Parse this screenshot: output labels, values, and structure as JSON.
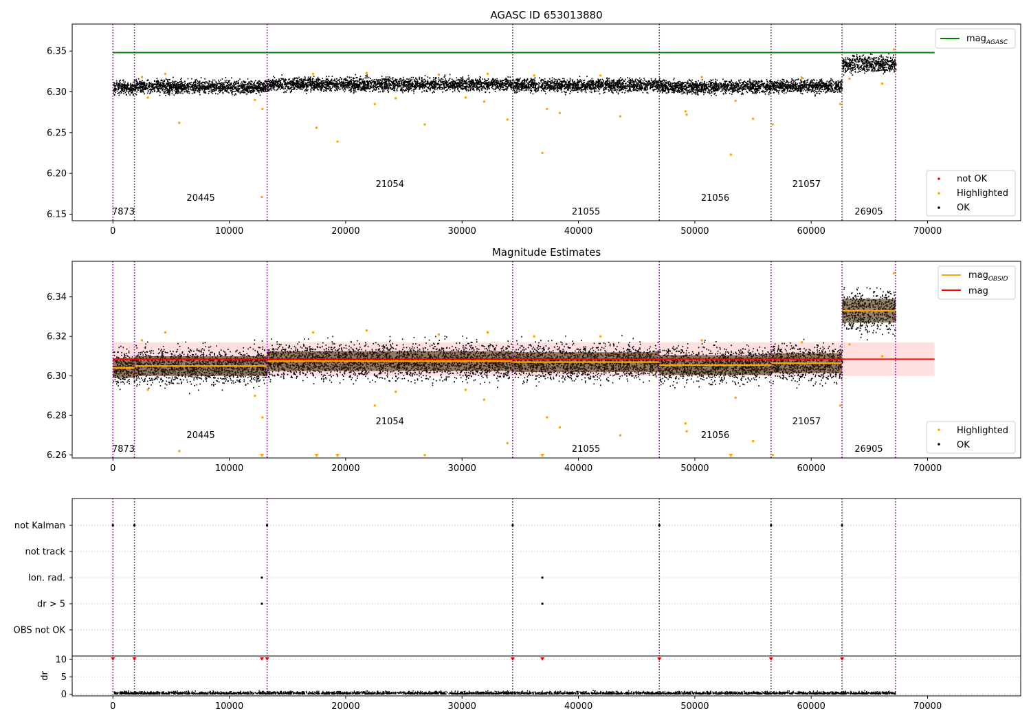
{
  "chart_data": [
    {
      "type": "scatter",
      "title": "AGASC ID 653013880",
      "xlim": [
        -3500,
        78000
      ],
      "ylim": [
        6.142,
        6.383
      ],
      "x_ticks": [
        0,
        10000,
        20000,
        30000,
        40000,
        50000,
        60000,
        70000
      ],
      "y_ticks": [
        6.15,
        6.2,
        6.25,
        6.3,
        6.35
      ],
      "obs_boundaries": [
        0,
        1850,
        13250,
        34350,
        46950,
        56550,
        62650,
        67250
      ],
      "obsid_labels": [
        {
          "text": "7873",
          "x": 900,
          "row": 2
        },
        {
          "text": "20445",
          "x": 7550,
          "row": 1
        },
        {
          "text": "21054",
          "x": 23800,
          "row": 0
        },
        {
          "text": "21055",
          "x": 40650,
          "row": 2
        },
        {
          "text": "21056",
          "x": 51750,
          "row": 1
        },
        {
          "text": "21057",
          "x": 59600,
          "row": 0
        },
        {
          "text": "26905",
          "x": 64950,
          "row": 2
        }
      ],
      "mag_agasc": 6.348,
      "series": [
        {
          "name": "OK",
          "color": "#000000",
          "segments": [
            {
              "x0": 0,
              "x1": 1850,
              "mean": 6.305,
              "spread": 0.008
            },
            {
              "x0": 1850,
              "x1": 13250,
              "mean": 6.306,
              "spread": 0.008
            },
            {
              "x0": 13250,
              "x1": 34350,
              "mean": 6.309,
              "spread": 0.008
            },
            {
              "x0": 34350,
              "x1": 46950,
              "mean": 6.308,
              "spread": 0.008
            },
            {
              "x0": 46950,
              "x1": 56550,
              "mean": 6.306,
              "spread": 0.008
            },
            {
              "x0": 56550,
              "x1": 62650,
              "mean": 6.307,
              "spread": 0.008
            },
            {
              "x0": 62650,
              "x1": 67250,
              "mean": 6.334,
              "spread": 0.01
            }
          ]
        },
        {
          "name": "Highlighted",
          "color": "#ffa500",
          "points": [
            [
              5700,
              6.262
            ],
            [
              12850,
              6.279
            ],
            [
              12800,
              6.171
            ],
            [
              17500,
              6.256
            ],
            [
              19300,
              6.239
            ],
            [
              22500,
              6.285
            ],
            [
              26800,
              6.26
            ],
            [
              33900,
              6.266
            ],
            [
              36900,
              6.225
            ],
            [
              37300,
              6.279
            ],
            [
              38400,
              6.274
            ],
            [
              43600,
              6.27
            ],
            [
              49200,
              6.276
            ],
            [
              49300,
              6.272
            ],
            [
              53100,
              6.223
            ],
            [
              55000,
              6.267
            ],
            [
              56700,
              6.26
            ],
            [
              62500,
              6.285
            ],
            [
              12200,
              6.29
            ],
            [
              3000,
              6.293
            ],
            [
              24300,
              6.292
            ],
            [
              30300,
              6.293
            ],
            [
              31900,
              6.288
            ],
            [
              2500,
              6.318
            ],
            [
              4500,
              6.322
            ],
            [
              17200,
              6.322
            ],
            [
              21800,
              6.323
            ],
            [
              28000,
              6.321
            ],
            [
              32200,
              6.322
            ],
            [
              36200,
              6.32
            ],
            [
              41900,
              6.32
            ],
            [
              50600,
              6.318
            ],
            [
              53500,
              6.289
            ],
            [
              59200,
              6.317
            ],
            [
              63300,
              6.316
            ],
            [
              66100,
              6.31
            ],
            [
              67100,
              6.352
            ]
          ]
        },
        {
          "name": "not OK",
          "color": "#ff0000",
          "points": []
        }
      ],
      "legends": {
        "top": [
          "mag_AGASC"
        ],
        "bottom": [
          "not OK",
          "Highlighted",
          "OK"
        ]
      }
    },
    {
      "type": "scatter",
      "title": "Magnitude Estimates",
      "xlim": [
        -3500,
        78000
      ],
      "ylim": [
        6.2585,
        6.358
      ],
      "x_ticks": [
        0,
        10000,
        20000,
        30000,
        40000,
        50000,
        60000,
        70000
      ],
      "y_ticks": [
        6.26,
        6.28,
        6.3,
        6.32,
        6.34
      ],
      "mag": 6.3085,
      "mag_band": [
        6.3,
        6.317
      ],
      "mag_obsid": [
        {
          "x0": 0,
          "x1": 1850,
          "value": 6.304,
          "std": 0.005
        },
        {
          "x0": 1850,
          "x1": 13250,
          "value": 6.305,
          "std": 0.005
        },
        {
          "x0": 13250,
          "x1": 34350,
          "value": 6.3075,
          "std": 0.005
        },
        {
          "x0": 34350,
          "x1": 46950,
          "value": 6.307,
          "std": 0.005
        },
        {
          "x0": 46950,
          "x1": 56550,
          "value": 6.3055,
          "std": 0.005
        },
        {
          "x0": 56550,
          "x1": 62650,
          "value": 6.3065,
          "std": 0.005
        },
        {
          "x0": 62650,
          "x1": 67250,
          "value": 6.333,
          "std": 0.006
        }
      ],
      "lower_limit_markers": [
        12800,
        17500,
        19300,
        36900,
        53100
      ],
      "legends": {
        "top": [
          "mag_OBSID",
          "mag"
        ],
        "bottom": [
          "Highlighted",
          "OK"
        ]
      }
    },
    {
      "type": "scatter",
      "title": "",
      "xlim": [
        -3500,
        78000
      ],
      "categories": [
        "not Kalman",
        "not track",
        "Ion. rad.",
        "dr > 5",
        "OBS not OK"
      ],
      "flag_points": {
        "not Kalman": [
          0,
          1850,
          13250,
          34350,
          46950,
          56550,
          62650
        ],
        "not track": [],
        "Ion. rad.": [
          12800,
          36900
        ],
        "dr > 5": [
          12800,
          36900
        ],
        "OBS not OK": []
      },
      "dr_ylim": [
        -0.5,
        11
      ],
      "dr_ticks": [
        0,
        5,
        10
      ],
      "dr_label": "dr",
      "dr_spike_markers": [
        0,
        1850,
        12800,
        13250,
        34350,
        36900,
        46950,
        56550,
        62650
      ]
    }
  ],
  "colors": {
    "ok": "#000000",
    "highlighted": "#ffa500",
    "not_ok": "#ff0000",
    "agasc_line": "#008000",
    "mag_line": "#ff0000",
    "mag_obsid": "#ffa500",
    "boundary": "#800080"
  }
}
